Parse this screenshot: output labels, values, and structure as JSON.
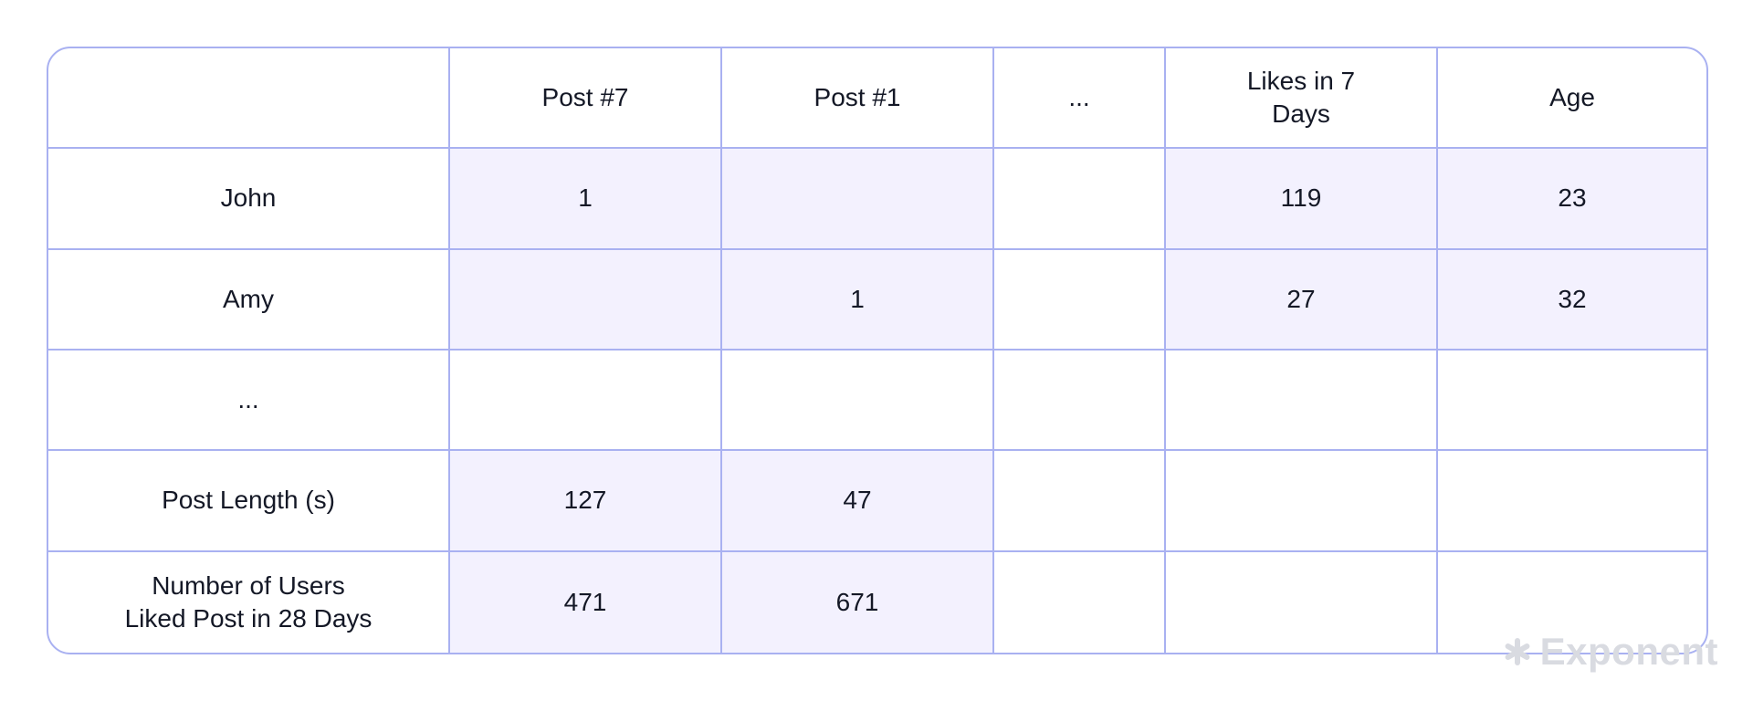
{
  "table": {
    "headers": [
      "",
      "Post #7",
      "Post #1",
      "...",
      "Likes in 7\nDays",
      "Age"
    ],
    "rows": [
      {
        "label": "John",
        "cells": [
          "1",
          "",
          "",
          "119",
          "23"
        ],
        "shaded": [
          true,
          true,
          false,
          true,
          true
        ]
      },
      {
        "label": "Amy",
        "cells": [
          "",
          "1",
          "",
          "27",
          "32"
        ],
        "shaded": [
          true,
          true,
          false,
          true,
          true
        ]
      },
      {
        "label": "...",
        "cells": [
          "",
          "",
          "",
          "",
          ""
        ],
        "shaded": [
          false,
          false,
          false,
          false,
          false
        ]
      },
      {
        "label": "Post Length (s)",
        "cells": [
          "127",
          "47",
          "",
          "",
          ""
        ],
        "shaded": [
          true,
          true,
          false,
          false,
          false
        ]
      },
      {
        "label": "Number of Users\nLiked Post in 28 Days",
        "cells": [
          "471",
          "671",
          "",
          "",
          ""
        ],
        "shaded": [
          true,
          true,
          false,
          false,
          false
        ]
      }
    ]
  },
  "colors": {
    "grid_border": "#a9b1f1",
    "shade": "#f3f1fe",
    "text": "#141826"
  },
  "watermark": {
    "text": "Exponent",
    "icon": "asterisk-icon"
  }
}
